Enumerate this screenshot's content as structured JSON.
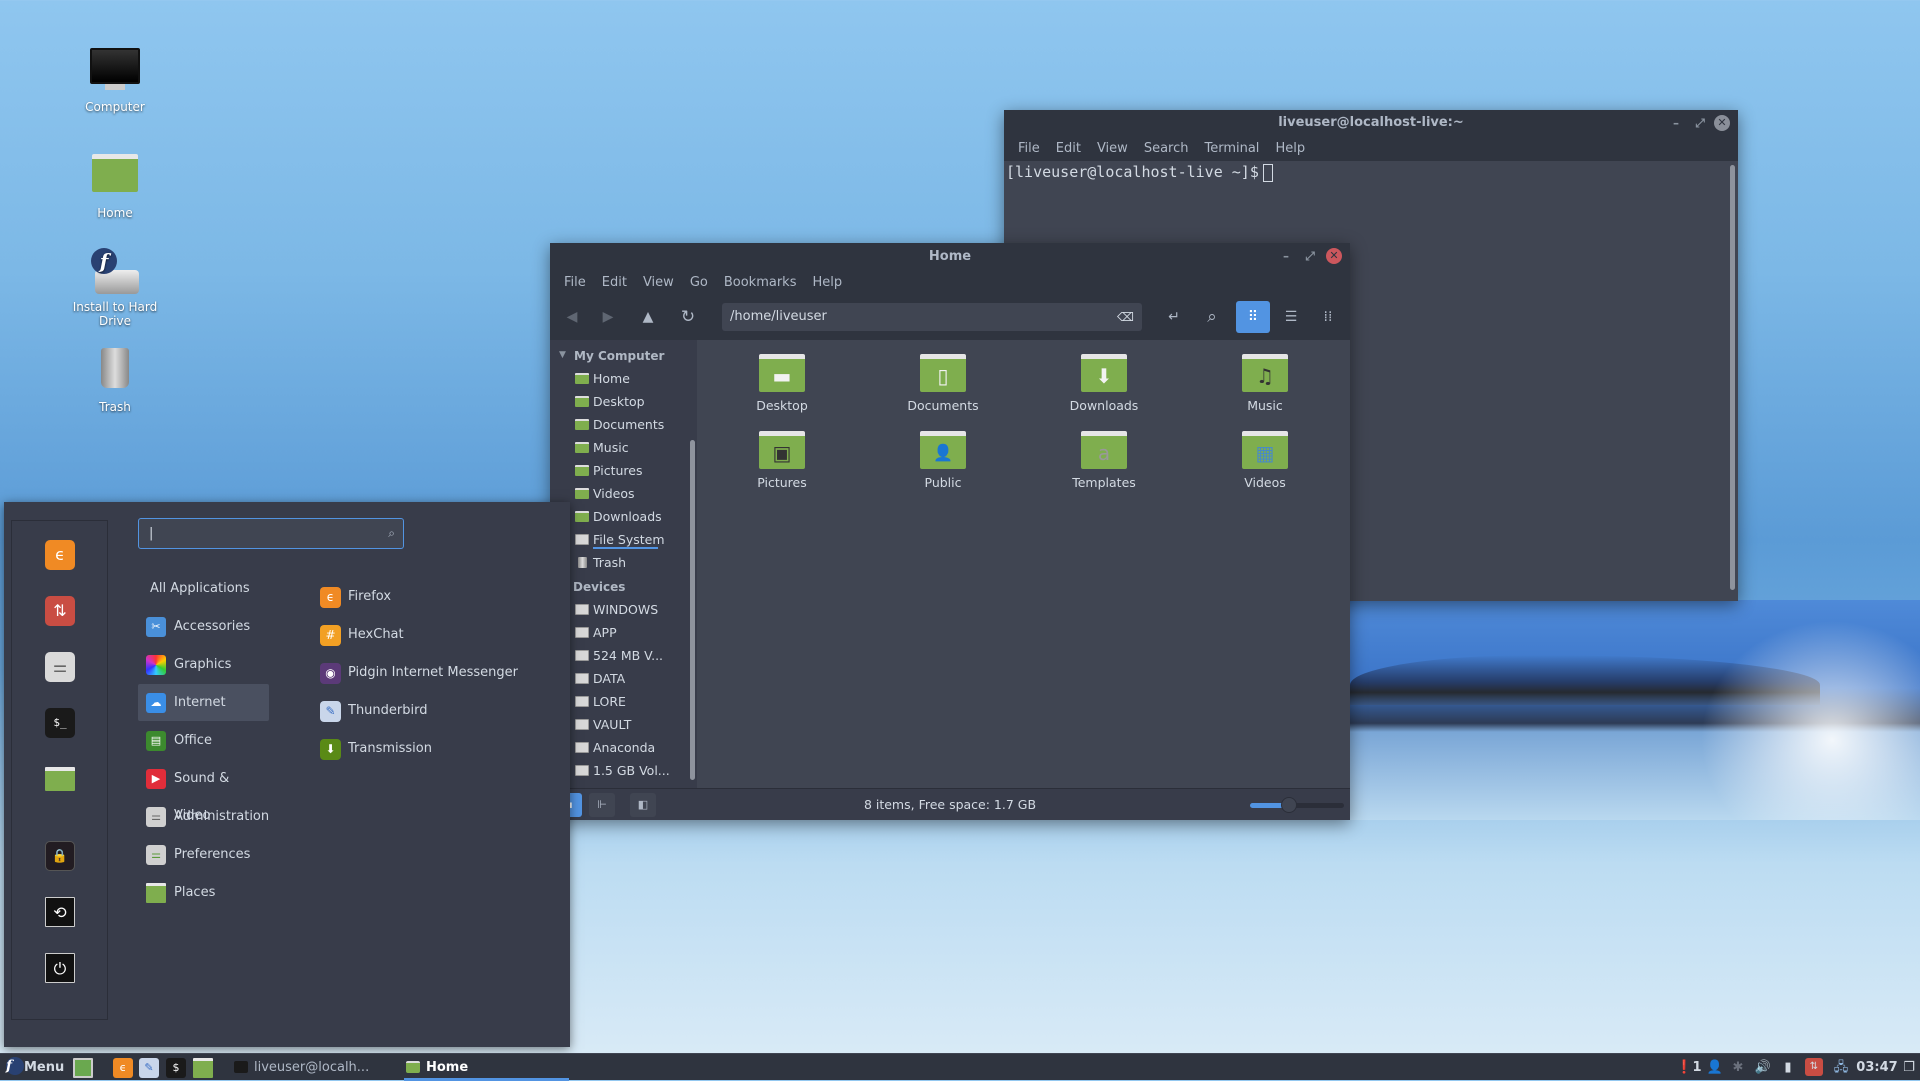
{
  "desktop": {
    "icons": [
      {
        "label": "Computer",
        "icon": "computer-icon"
      },
      {
        "label": "Home",
        "icon": "home-folder-icon"
      },
      {
        "label": "Install to Hard Drive",
        "icon": "install-drive-icon"
      },
      {
        "label": "Trash",
        "icon": "trash-icon"
      }
    ]
  },
  "terminal": {
    "title": "liveuser@localhost-live:~",
    "menu": [
      "File",
      "Edit",
      "View",
      "Search",
      "Terminal",
      "Help"
    ],
    "prompt": "[liveuser@localhost-live ~]$",
    "controls": {
      "minimize": "–",
      "maximize": "⤢",
      "close": "✕"
    }
  },
  "file_manager": {
    "title": "Home",
    "menu": [
      "File",
      "Edit",
      "View",
      "Go",
      "Bookmarks",
      "Help"
    ],
    "toolbar": {
      "back": "◀",
      "forward": "▶",
      "up": "▲",
      "reload": "↻",
      "location": "/home/liveuser",
      "clear": "⌫",
      "toggle_location": "↵",
      "search": "⌕",
      "view_icons": "⠿",
      "view_list": "☰",
      "view_compact": "⁞⁞"
    },
    "sidebar": {
      "my_computer_header": "My Computer",
      "places": [
        {
          "label": "Home",
          "icon": "folder"
        },
        {
          "label": "Desktop",
          "icon": "folder"
        },
        {
          "label": "Documents",
          "icon": "folder"
        },
        {
          "label": "Music",
          "icon": "folder"
        },
        {
          "label": "Pictures",
          "icon": "folder"
        },
        {
          "label": "Videos",
          "icon": "folder"
        },
        {
          "label": "Downloads",
          "icon": "folder"
        },
        {
          "label": "File System",
          "icon": "drive"
        },
        {
          "label": "Trash",
          "icon": "trash"
        }
      ],
      "devices_header": "Devices",
      "devices": [
        "WINDOWS",
        "APP",
        "524 MB V...",
        "DATA",
        "LORE",
        "VAULT",
        "Anaconda",
        "1.5 GB Vol..."
      ]
    },
    "items": [
      {
        "label": "Desktop",
        "glyph": "▬"
      },
      {
        "label": "Documents",
        "glyph": "▯"
      },
      {
        "label": "Downloads",
        "glyph": "⬇"
      },
      {
        "label": "Music",
        "glyph": "♫"
      },
      {
        "label": "Pictures",
        "glyph": "▣"
      },
      {
        "label": "Public",
        "glyph": "👤"
      },
      {
        "label": "Templates",
        "glyph": "a"
      },
      {
        "label": "Videos",
        "glyph": "▦"
      }
    ],
    "status": "8 items, Free space: 1.7 GB",
    "zoom_level": 0.42,
    "controls": {
      "minimize": "–",
      "maximize": "⤢",
      "close": "✕"
    }
  },
  "app_menu": {
    "search_value": "|",
    "search_icon": "⌕",
    "favorites": [
      {
        "name": "firefox",
        "glyph": "ϵ",
        "color": "#f08a24"
      },
      {
        "name": "software-installer",
        "glyph": "⇅",
        "color": "#c94d43"
      },
      {
        "name": "settings",
        "glyph": "⚌",
        "color": "#dadada"
      },
      {
        "name": "terminal",
        "glyph": "$_",
        "color": "#1a1a1a"
      },
      {
        "name": "files",
        "glyph": "",
        "color": "#7fae4e"
      },
      {
        "name": "lock-screen",
        "glyph": "🔒",
        "color": "#221c22"
      },
      {
        "name": "logout",
        "glyph": "⟲",
        "color": "#111111"
      },
      {
        "name": "shutdown",
        "glyph": "⏻",
        "color": "#111111"
      }
    ],
    "all_applications": "All Applications",
    "categories": [
      {
        "label": "Accessories",
        "glyph": "✂",
        "color": "#4a90d9"
      },
      {
        "label": "Graphics",
        "glyph": "",
        "color": "#b03ac9"
      },
      {
        "label": "Internet",
        "glyph": "☁",
        "color": "#3a8ee6",
        "selected": true
      },
      {
        "label": "Office",
        "glyph": "▤",
        "color": "#3c8a2e"
      },
      {
        "label": "Sound & Video",
        "glyph": "▶",
        "color": "#e02d3a"
      },
      {
        "label": "Administration",
        "glyph": "⚌",
        "color": "#d0d0d0"
      },
      {
        "label": "Preferences",
        "glyph": "⚌",
        "color": "#d0d0d0"
      },
      {
        "label": "Places",
        "glyph": "",
        "color": "#7fae4e"
      }
    ],
    "apps": [
      {
        "label": "Firefox",
        "glyph": "ϵ",
        "color": "#f08a24"
      },
      {
        "label": "HexChat",
        "glyph": "#",
        "color": "#f2a024"
      },
      {
        "label": "Pidgin Internet Messenger",
        "glyph": "◉",
        "color": "#5b3a78"
      },
      {
        "label": "Thunderbird",
        "glyph": "✎",
        "color": "#c9d6ea"
      },
      {
        "label": "Transmission",
        "glyph": "⬇",
        "color": "#5a8a16"
      }
    ]
  },
  "taskbar": {
    "menu_label": "Menu",
    "launchers": [
      {
        "name": "show-desktop",
        "color": "#6aa84f"
      },
      {
        "name": "firefox",
        "glyph": "ϵ",
        "color": "#f08a24"
      },
      {
        "name": "thunderbird",
        "glyph": "✎",
        "color": "#c9d6ea"
      },
      {
        "name": "terminal",
        "glyph": "$",
        "color": "#1a1a1a"
      },
      {
        "name": "files",
        "glyph": "",
        "color": "#7fae4e"
      }
    ],
    "windows": [
      {
        "label": "liveuser@localh...",
        "active": false
      },
      {
        "label": "Home",
        "active": true
      }
    ],
    "tray": {
      "notifications": "❗1",
      "user": "👤",
      "bluetooth": "✱",
      "volume": "🔊",
      "battery": "▮",
      "updates": "⇅",
      "network": "🖧",
      "clock": "03:47",
      "workspace": "❐"
    }
  }
}
